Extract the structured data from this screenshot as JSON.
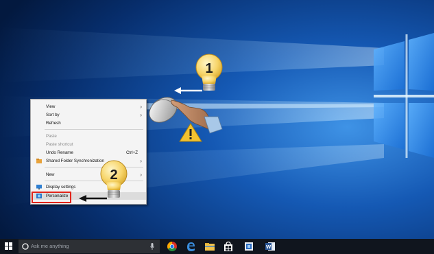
{
  "context_menu": {
    "items": [
      {
        "label": "View",
        "submenu": true
      },
      {
        "label": "Sort by",
        "submenu": true
      },
      {
        "label": "Refresh"
      },
      {
        "label": "Paste",
        "disabled": true
      },
      {
        "label": "Paste shortcut",
        "disabled": true
      },
      {
        "label": "Undo Rename",
        "shortcut": "Ctrl+Z"
      },
      {
        "label": "Shared Folder Synchronization",
        "submenu": true
      },
      {
        "label": "New",
        "submenu": true
      },
      {
        "label": "Display settings"
      },
      {
        "label": "Personalize",
        "highlighted": true
      }
    ]
  },
  "callouts": {
    "step1": "1",
    "step2": "2"
  },
  "taskbar": {
    "search_placeholder": "Ask me anything",
    "icons": [
      "start-icon",
      "cortana-circle-icon",
      "microphone-icon",
      "chrome-icon",
      "edge-icon",
      "file-explorer-icon",
      "store-icon",
      "app-icon",
      "word-icon"
    ]
  },
  "colors": {
    "desktop_blue": "#0a3d85",
    "taskbar": "#10151e",
    "highlight_box": "#e1251b",
    "bulb_yellow": "#f7d56a"
  }
}
